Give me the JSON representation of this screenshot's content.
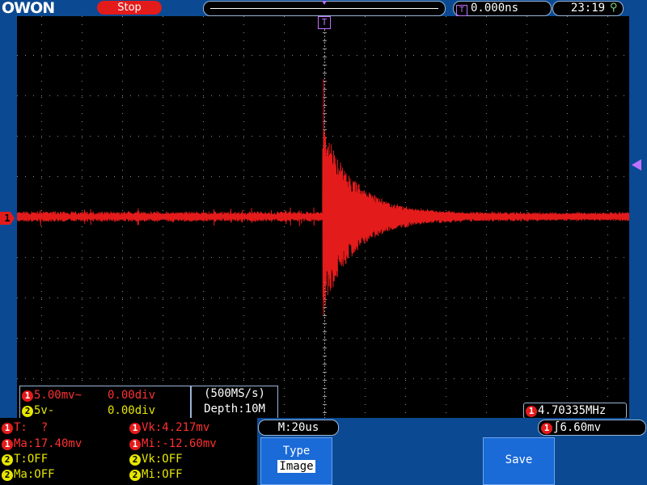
{
  "top": {
    "logo": "OWON",
    "run_state": "Stop",
    "trigger_position": "0.000ns",
    "trigger_icon": "T",
    "clock": "23:19",
    "usb_icon": "usb-icon"
  },
  "screen": {
    "ch1_marker": "1",
    "trigger_marker": "T",
    "waveform_color": "#e41b1b",
    "trigger_color": "#c070ff"
  },
  "channels": {
    "ch1": {
      "num": "1",
      "scale": "5.00mv~",
      "offset": "0.00div"
    },
    "ch2": {
      "num": "2",
      "scale": "5v-",
      "offset": "0.00div"
    }
  },
  "acquisition": {
    "sample_rate": "(500MS/s)",
    "depth": "Depth:10M"
  },
  "frequency": {
    "num": "1",
    "value": "4.70335MHz"
  },
  "timebase": "M:20us",
  "trigger": {
    "num": "1",
    "level": "6.60mv"
  },
  "measurements": {
    "r1c1": {
      "num": "1",
      "text": "T:  ?"
    },
    "r1c2": {
      "num": "1",
      "text": "Vk:4.217mv"
    },
    "r2c1": {
      "num": "1",
      "text": "Ma:17.40mv"
    },
    "r2c2": {
      "num": "1",
      "text": "Mi:-12.60mv"
    },
    "r3c1": {
      "num": "2",
      "text": "T:OFF"
    },
    "r3c2": {
      "num": "2",
      "text": "Vk:OFF"
    },
    "r4c1": {
      "num": "2",
      "text": "Ma:OFF"
    },
    "r4c2": {
      "num": "2",
      "text": "Mi:OFF"
    }
  },
  "softkeys": {
    "type_label": "Type",
    "type_value": "Image",
    "save_label": "Save"
  }
}
